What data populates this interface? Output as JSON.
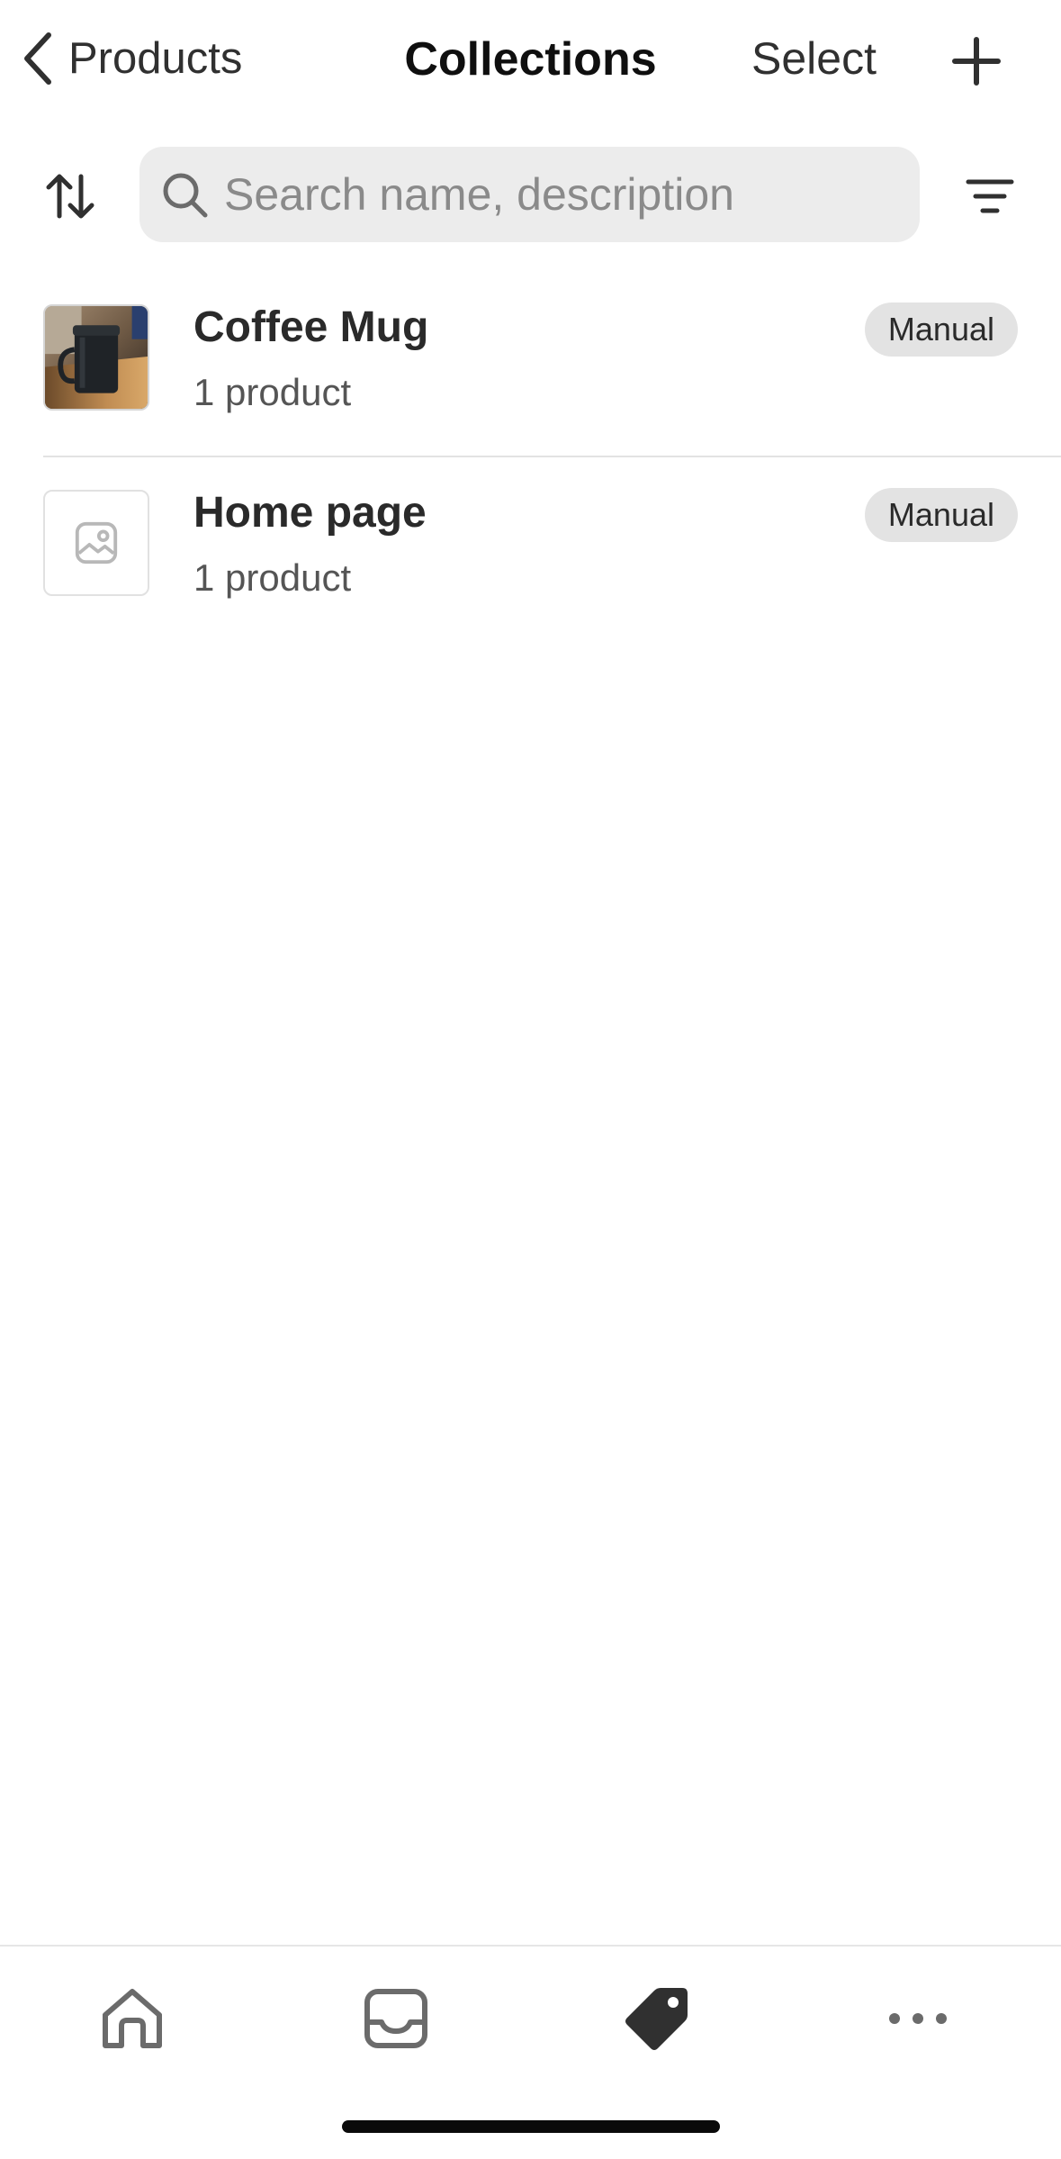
{
  "nav": {
    "back_label": "Products",
    "title": "Collections",
    "select_label": "Select"
  },
  "search": {
    "placeholder": "Search name, description",
    "value": ""
  },
  "collections": [
    {
      "title": "Coffee Mug",
      "subtitle": "1 product",
      "badge": "Manual",
      "thumbnail": "mug-photo"
    },
    {
      "title": "Home page",
      "subtitle": "1 product",
      "badge": "Manual",
      "thumbnail": "image-placeholder-icon"
    }
  ],
  "tabs": [
    {
      "icon": "home-icon",
      "active": false
    },
    {
      "icon": "inbox-icon",
      "active": false
    },
    {
      "icon": "tag-icon",
      "active": true
    },
    {
      "icon": "more-icon",
      "active": false
    }
  ],
  "colors": {
    "text": "#303030",
    "search_bg": "#ececec",
    "badge_bg": "#e3e3e3",
    "active_tab": "#303030",
    "inactive_tab": "#6b6b6b"
  }
}
